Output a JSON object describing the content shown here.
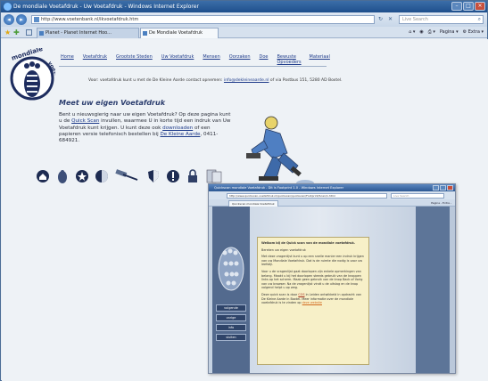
{
  "window": {
    "title": "De mondiale Voetafdruk - Uw Voetafdruk - Windows Internet Explorer",
    "url": "http://www.voetenbank.nl/ikvoetafdruk.htm",
    "search_placeholder": "Live Search"
  },
  "tabs": [
    {
      "label": "Planet - Planet Internet Hoo..."
    },
    {
      "label": "De Mondiale Voetafdruk"
    }
  ],
  "command_bar": {
    "pagina": "Pagina",
    "extra": "Extra"
  },
  "site": {
    "logo_text": "mondiale voetafdruk",
    "menu": [
      "Home",
      "Voetafdruk",
      "Grootste Steden",
      "Uw Voetafdruk",
      "Mensen",
      "Oorzaken",
      "Doe",
      "Bewuste Opvoeders",
      "Materiaal"
    ],
    "note_prefix": "Voor: voetafdruk kunt u met de De Kleine Aarde contact opnemen:",
    "note_email": "info@dekleineaarde.nl",
    "note_suffix": "of via Postbus 151, 5280 AD Boxtel.",
    "heading": "Meet uw eigen Voetafdruk",
    "intro_1": "Bent u nieuwsgierig naar uw eigen Voetafdruk? Op deze pagina kunt u de",
    "intro_link1": "Quick Scan",
    "intro_2": "invullen, waarmee U in korte tijd een indruk van Uw Voetafdruk kunt krijgen. U kunt deze ook",
    "intro_link2": "downloaden",
    "intro_3": "of een papieren versie telefonisch bestellen bij",
    "intro_link3": "De Kleine Aarde",
    "intro_4": ", 0411-684921."
  },
  "inner_window": {
    "title": "Quickscan mondiale Voetafdruk - Dit is Footprint 1.0 - Windows Internet Explorer",
    "url": "http://www.quickscan.voetafdruk.nl/quickscan/quickscan/Footprint/Scan/1.html",
    "tab": "Quickscan mondiale Voetafdruk",
    "search_placeholder": "Live Search",
    "cmd": "Pagina - Extra -",
    "buttons": [
      "volgende",
      "vorige",
      "info",
      "sluiten"
    ],
    "panel_title": "Welkom bij de Quick scan van de mondiale voetafdruk.",
    "panel_sub": "Bereken uw eigen voetafdruk",
    "panel_p1": "Met deze vragenlijst kunt u op een snelle manier een indruk krijgen van uw Mondiale Voetafdruk. Dat is de ruimte die nodig is voor uw leefstijl.",
    "panel_p2": "Voor u de vragenlijst gaat doorlopen zijn enkele opmerkingen van belang. Maakt u bij het doorlopen steeds gebruik van de knoppen links op het scherm. Maak geen gebruik van de knop Back of Vorig van uw browser. Na de vragenlijst vindt u de uitslag en de knop volgend helpt u op weg.",
    "panel_p3_a": "Deze quick scan is door",
    "panel_p3_link": "COS",
    "panel_p3_b": "in Leiden ontwikkeld in opdracht van De Kleine Aarde in Boxtel. Meer informatie over de mondiale voetafdruk is te vinden op",
    "panel_p3_link2": "deze website"
  },
  "colors": {
    "menu_link": "#1e3b8a",
    "heading": "#2b3d6e",
    "sidebar": "#536a8e",
    "panel": "#f7f0c8"
  }
}
